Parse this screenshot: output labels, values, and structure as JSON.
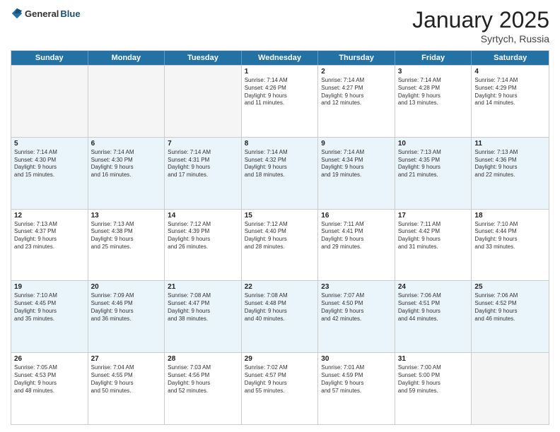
{
  "header": {
    "logo_general": "General",
    "logo_blue": "Blue",
    "title": "January 2025",
    "location": "Syrtych, Russia"
  },
  "days_of_week": [
    "Sunday",
    "Monday",
    "Tuesday",
    "Wednesday",
    "Thursday",
    "Friday",
    "Saturday"
  ],
  "weeks": [
    [
      {
        "day": "",
        "info": ""
      },
      {
        "day": "",
        "info": ""
      },
      {
        "day": "",
        "info": ""
      },
      {
        "day": "1",
        "info": "Sunrise: 7:14 AM\nSunset: 4:26 PM\nDaylight: 9 hours\nand 11 minutes."
      },
      {
        "day": "2",
        "info": "Sunrise: 7:14 AM\nSunset: 4:27 PM\nDaylight: 9 hours\nand 12 minutes."
      },
      {
        "day": "3",
        "info": "Sunrise: 7:14 AM\nSunset: 4:28 PM\nDaylight: 9 hours\nand 13 minutes."
      },
      {
        "day": "4",
        "info": "Sunrise: 7:14 AM\nSunset: 4:29 PM\nDaylight: 9 hours\nand 14 minutes."
      }
    ],
    [
      {
        "day": "5",
        "info": "Sunrise: 7:14 AM\nSunset: 4:30 PM\nDaylight: 9 hours\nand 15 minutes."
      },
      {
        "day": "6",
        "info": "Sunrise: 7:14 AM\nSunset: 4:30 PM\nDaylight: 9 hours\nand 16 minutes."
      },
      {
        "day": "7",
        "info": "Sunrise: 7:14 AM\nSunset: 4:31 PM\nDaylight: 9 hours\nand 17 minutes."
      },
      {
        "day": "8",
        "info": "Sunrise: 7:14 AM\nSunset: 4:32 PM\nDaylight: 9 hours\nand 18 minutes."
      },
      {
        "day": "9",
        "info": "Sunrise: 7:14 AM\nSunset: 4:34 PM\nDaylight: 9 hours\nand 19 minutes."
      },
      {
        "day": "10",
        "info": "Sunrise: 7:13 AM\nSunset: 4:35 PM\nDaylight: 9 hours\nand 21 minutes."
      },
      {
        "day": "11",
        "info": "Sunrise: 7:13 AM\nSunset: 4:36 PM\nDaylight: 9 hours\nand 22 minutes."
      }
    ],
    [
      {
        "day": "12",
        "info": "Sunrise: 7:13 AM\nSunset: 4:37 PM\nDaylight: 9 hours\nand 23 minutes."
      },
      {
        "day": "13",
        "info": "Sunrise: 7:13 AM\nSunset: 4:38 PM\nDaylight: 9 hours\nand 25 minutes."
      },
      {
        "day": "14",
        "info": "Sunrise: 7:12 AM\nSunset: 4:39 PM\nDaylight: 9 hours\nand 26 minutes."
      },
      {
        "day": "15",
        "info": "Sunrise: 7:12 AM\nSunset: 4:40 PM\nDaylight: 9 hours\nand 28 minutes."
      },
      {
        "day": "16",
        "info": "Sunrise: 7:11 AM\nSunset: 4:41 PM\nDaylight: 9 hours\nand 29 minutes."
      },
      {
        "day": "17",
        "info": "Sunrise: 7:11 AM\nSunset: 4:42 PM\nDaylight: 9 hours\nand 31 minutes."
      },
      {
        "day": "18",
        "info": "Sunrise: 7:10 AM\nSunset: 4:44 PM\nDaylight: 9 hours\nand 33 minutes."
      }
    ],
    [
      {
        "day": "19",
        "info": "Sunrise: 7:10 AM\nSunset: 4:45 PM\nDaylight: 9 hours\nand 35 minutes."
      },
      {
        "day": "20",
        "info": "Sunrise: 7:09 AM\nSunset: 4:46 PM\nDaylight: 9 hours\nand 36 minutes."
      },
      {
        "day": "21",
        "info": "Sunrise: 7:08 AM\nSunset: 4:47 PM\nDaylight: 9 hours\nand 38 minutes."
      },
      {
        "day": "22",
        "info": "Sunrise: 7:08 AM\nSunset: 4:48 PM\nDaylight: 9 hours\nand 40 minutes."
      },
      {
        "day": "23",
        "info": "Sunrise: 7:07 AM\nSunset: 4:50 PM\nDaylight: 9 hours\nand 42 minutes."
      },
      {
        "day": "24",
        "info": "Sunrise: 7:06 AM\nSunset: 4:51 PM\nDaylight: 9 hours\nand 44 minutes."
      },
      {
        "day": "25",
        "info": "Sunrise: 7:06 AM\nSunset: 4:52 PM\nDaylight: 9 hours\nand 46 minutes."
      }
    ],
    [
      {
        "day": "26",
        "info": "Sunrise: 7:05 AM\nSunset: 4:53 PM\nDaylight: 9 hours\nand 48 minutes."
      },
      {
        "day": "27",
        "info": "Sunrise: 7:04 AM\nSunset: 4:55 PM\nDaylight: 9 hours\nand 50 minutes."
      },
      {
        "day": "28",
        "info": "Sunrise: 7:03 AM\nSunset: 4:56 PM\nDaylight: 9 hours\nand 52 minutes."
      },
      {
        "day": "29",
        "info": "Sunrise: 7:02 AM\nSunset: 4:57 PM\nDaylight: 9 hours\nand 55 minutes."
      },
      {
        "day": "30",
        "info": "Sunrise: 7:01 AM\nSunset: 4:59 PM\nDaylight: 9 hours\nand 57 minutes."
      },
      {
        "day": "31",
        "info": "Sunrise: 7:00 AM\nSunset: 5:00 PM\nDaylight: 9 hours\nand 59 minutes."
      },
      {
        "day": "",
        "info": ""
      }
    ]
  ]
}
